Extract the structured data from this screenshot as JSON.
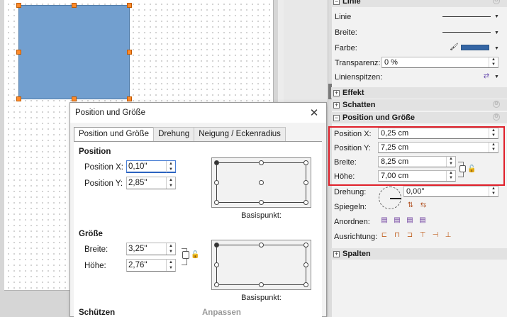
{
  "colors": {
    "shape_fill": "#729fcf",
    "handle": "#ff8a2a",
    "line_color": "#3465a4",
    "highlight": "#e0202a"
  },
  "dialog": {
    "title": "Position und Größe",
    "tabs": [
      "Position und Größe",
      "Drehung",
      "Neigung / Eckenradius"
    ],
    "position": {
      "heading": "Position",
      "x_label": "Position X:",
      "x_value": "0,10\"",
      "y_label": "Position Y:",
      "y_value": "2,85\"",
      "basepoint_caption": "Basispunkt:"
    },
    "size": {
      "heading": "Größe",
      "width_label": "Breite:",
      "width_value": "3,25\"",
      "height_label": "Höhe:",
      "height_value": "2,76\"",
      "basepoint_caption": "Basispunkt:"
    },
    "protect_heading": "Schützen",
    "adjust_heading": "Anpassen"
  },
  "sidebar": {
    "line_panel": {
      "title": "Linie",
      "line_label": "Linie",
      "width_label": "Breite:",
      "color_label": "Farbe:",
      "transparency_label": "Transparenz:",
      "transparency_value": "0 %",
      "arrows_label": "Linienspitzen:"
    },
    "effect_title": "Effekt",
    "shadow_title": "Schatten",
    "possize_panel": {
      "title": "Position und Größe",
      "x_label": "Position X:",
      "x_value": "0,25 cm",
      "y_label": "Position Y:",
      "y_value": "7,25 cm",
      "width_label": "Breite:",
      "width_value": "8,25 cm",
      "height_label": "Höhe:",
      "height_value": "7,00 cm",
      "rotation_label": "Drehung:",
      "rotation_value": "0,00°",
      "flip_label": "Spiegeln:",
      "arrange_label": "Anordnen:",
      "align_label": "Ausrichtung:"
    },
    "columns_title": "Spalten"
  }
}
